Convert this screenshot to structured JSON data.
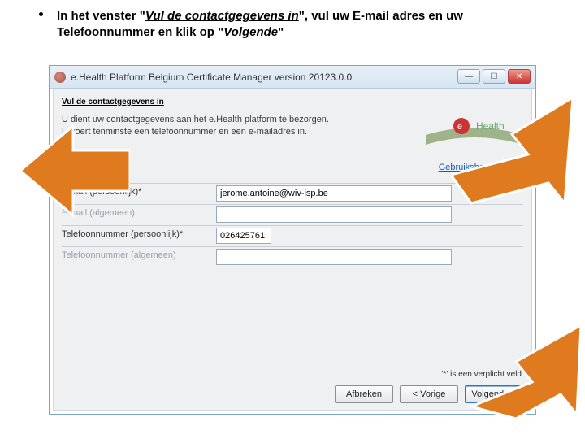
{
  "instruction": {
    "pre": "In het venster \"",
    "em1": "Vul de contactgegevens in",
    "mid": "\", vul uw E-mail adres en uw Telefoonnummer en klik op \"",
    "em2": "Volgende",
    "post": "\""
  },
  "window": {
    "title": "e.Health Platform Belgium Certificate Manager    version 20123.0.0"
  },
  "panel": {
    "header": "Vul de contactgegevens in",
    "desc_line1": "U dient uw contactgegevens aan het e.Health platform te bezorgen.",
    "desc_line2": "U voert tenminste een telefoonnummer en een e-mailadres in.",
    "logo_text": "Health",
    "link": "Gebruikshandleiding",
    "required_note": "'*' is een verplicht veld"
  },
  "form": {
    "rows": [
      {
        "label": "E-mail (persoonlijk)*",
        "value": "jerome.antoine@wiv-isp.be",
        "short": false,
        "faded": false
      },
      {
        "label": "E-mail (algemeen)",
        "value": "",
        "short": false,
        "faded": true
      },
      {
        "label": "Telefoonnummer (persoonlijk)*",
        "value": "026425761",
        "short": true,
        "faded": false
      },
      {
        "label": "Telefoonnummer (algemeen)",
        "value": "",
        "short": false,
        "faded": true
      }
    ]
  },
  "buttons": {
    "cancel": "Afbreken",
    "back": "< Vorige",
    "next": "Volgende >"
  },
  "colors": {
    "arrow": "#e07a1f",
    "arrow_border": "#ffffff"
  }
}
